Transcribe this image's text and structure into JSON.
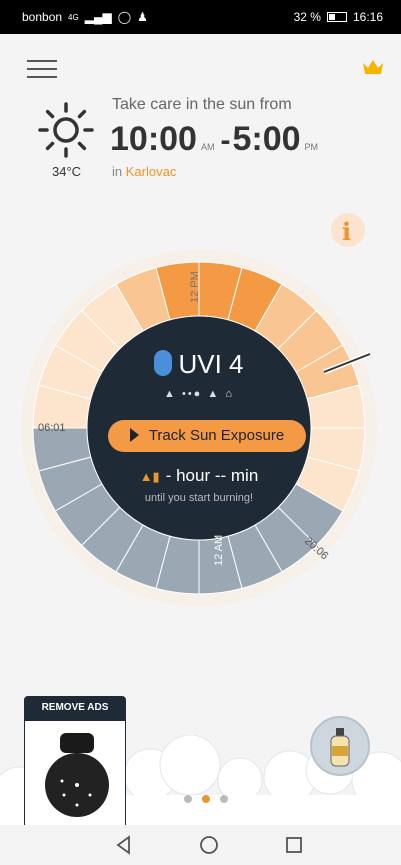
{
  "status_bar": {
    "carrier": "bonbon",
    "network": "4G",
    "battery": "32 %",
    "time": "16:16"
  },
  "header": {
    "temperature": "34°C",
    "care_text": "Take care in the sun from",
    "start_time": "10:00",
    "start_period": "AM",
    "separator": "-",
    "end_time": "5:00",
    "end_period": "PM",
    "location_prefix": "in",
    "location": "Karlovac"
  },
  "dial": {
    "label_sunrise": "06:01",
    "label_sunset": "20:06",
    "label_noon": "12 PM",
    "label_midnight": "12 AM",
    "uvi_label": "UVI 4",
    "icons_row": "▲ ••● ▲ ⌂",
    "track_button": "Track Sun Exposure",
    "hour_text": "- hour -- min",
    "burn_text": "until you start burning!"
  },
  "ads": {
    "remove_label": "REMOVE ADS"
  },
  "pager": {
    "pages": 3,
    "active_index": 1
  },
  "colors": {
    "accent": "#f0932b",
    "dial_dark": "#1e2a35",
    "night": "#9aa8b4",
    "day_light": "#fde4cc",
    "day_mid": "#f9c592",
    "day_peak": "#f49a45"
  },
  "icons": [
    "hamburger-menu-icon",
    "crown-icon",
    "sun-icon",
    "info-icon",
    "bluetooth-icon",
    "play-icon",
    "bottle-icon",
    "back-icon",
    "home-icon",
    "recents-icon"
  ]
}
